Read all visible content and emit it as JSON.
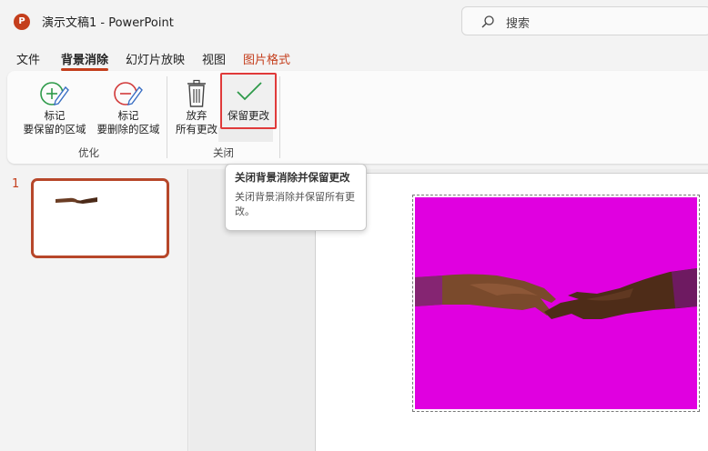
{
  "titlebar": {
    "app_badge": "P",
    "title": "演示文稿1  -  PowerPoint",
    "search_label": "搜索"
  },
  "menu": {
    "tabs": [
      "文件",
      "背景消除",
      "幻灯片放映",
      "视图",
      "图片格式"
    ]
  },
  "ribbon": {
    "mark_keep": {
      "line1": "标记",
      "line2": "要保留的区域"
    },
    "mark_remove": {
      "line1": "标记",
      "line2": "要删除的区域"
    },
    "discard": {
      "line1": "放弃",
      "line2": "所有更改"
    },
    "keep_changes": "保留更改",
    "group_refine": "优化",
    "group_close": "关闭"
  },
  "tooltip": {
    "title": "关闭背景消除并保留更改",
    "desc": "关闭背景消除并保留所有更改。"
  },
  "slides": {
    "current_number": "1"
  },
  "colors": {
    "accent": "#c43e1c",
    "picture_background": "#e000e0",
    "highlight_border": "#e03a3a"
  }
}
